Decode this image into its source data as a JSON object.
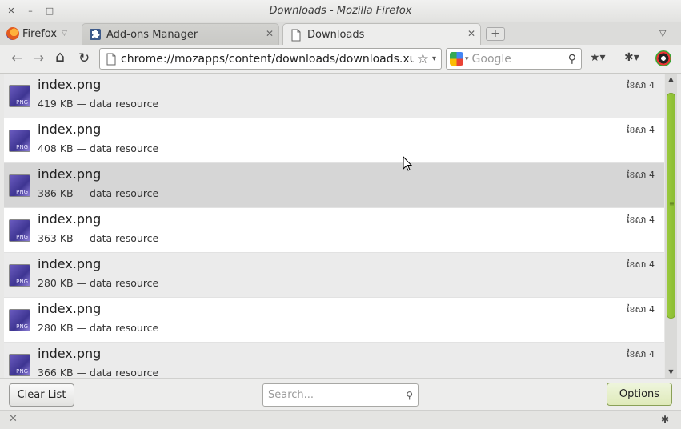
{
  "window": {
    "title": "Downloads - Mozilla Firefox",
    "close_glyph": "✕",
    "minimize_glyph": "–",
    "maximize_glyph": "□"
  },
  "tabs": {
    "firefox_menu_label": "Firefox",
    "items": [
      {
        "label": "Add-ons Manager",
        "icon": "puzzle-icon",
        "active": false
      },
      {
        "label": "Downloads",
        "icon": "page-icon",
        "active": true
      }
    ],
    "close_glyph": "✕",
    "new_tab_glyph": "+",
    "list_all_glyph": "▽"
  },
  "nav": {
    "back_glyph": "←",
    "forward_glyph": "→",
    "home_glyph": "⌂",
    "reload_glyph": "↻",
    "url": "chrome://mozapps/content/downloads/downloads.xul",
    "bookmark_glyph": "☆",
    "dropdown_glyph": "▾",
    "search_engine": "Google",
    "search_placeholder": "Google",
    "search_glyph": "⚲",
    "bookmarks_menu_glyph": "★▾",
    "addon_glyph": "✱▾"
  },
  "downloads": {
    "items": [
      {
        "name": "index.png",
        "meta": "419 KB — data resource",
        "date": "ខែសា 4",
        "selected": false
      },
      {
        "name": "index.png",
        "meta": "408 KB — data resource",
        "date": "ខែសា 4",
        "selected": false
      },
      {
        "name": "index.png",
        "meta": "386 KB — data resource",
        "date": "ខែសា 4",
        "selected": true
      },
      {
        "name": "index.png",
        "meta": "363 KB — data resource",
        "date": "ខែសា 4",
        "selected": false
      },
      {
        "name": "index.png",
        "meta": "280 KB — data resource",
        "date": "ខែសា 4",
        "selected": false
      },
      {
        "name": "index.png",
        "meta": "280 KB — data resource",
        "date": "ខែសា 4",
        "selected": false
      },
      {
        "name": "index.png",
        "meta": "366 KB — data resource",
        "date": "ខែសា 4",
        "selected": false
      }
    ],
    "file_tag": "PNG"
  },
  "scrollbar": {
    "up_glyph": "▲",
    "down_glyph": "▼"
  },
  "bottom": {
    "clear_list_label": "Clear List",
    "search_placeholder": "Search...",
    "search_glyph": "⚲",
    "options_label": "Options"
  },
  "status": {
    "close_glyph": "✕",
    "addon_glyph": "✱"
  },
  "colors": {
    "scroll_thumb": "#8bbd33",
    "selected_row": "#d6d6d6"
  }
}
